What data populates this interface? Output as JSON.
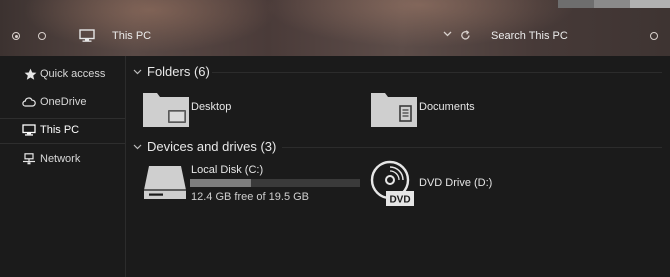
{
  "address": {
    "label": "This PC",
    "search_placeholder": "Search This PC"
  },
  "nav": {
    "items": [
      {
        "label": "Quick access",
        "icon": "star-icon"
      },
      {
        "label": "OneDrive",
        "icon": "cloud-icon"
      },
      {
        "label": "This PC",
        "icon": "monitor-icon",
        "active": true
      },
      {
        "label": "Network",
        "icon": "network-icon"
      }
    ]
  },
  "folders": {
    "header": "Folders (6)",
    "items": [
      {
        "label": "Desktop",
        "icon": "desktop-folder-icon"
      },
      {
        "label": "Documents",
        "icon": "documents-folder-icon"
      }
    ]
  },
  "devices": {
    "header": "Devices and drives (3)",
    "items": [
      {
        "label": "Local Disk (C:)",
        "free": "12.4 GB free of 19.5 GB",
        "used_fraction": 0.36,
        "icon": "hard-drive-icon"
      },
      {
        "label": "DVD Drive (D:)",
        "icon": "dvd-drive-icon"
      }
    ]
  },
  "colors": {
    "background": "#1b1b1b",
    "text": "#e6e6e6",
    "bar_fill": "#7d7d7d"
  }
}
